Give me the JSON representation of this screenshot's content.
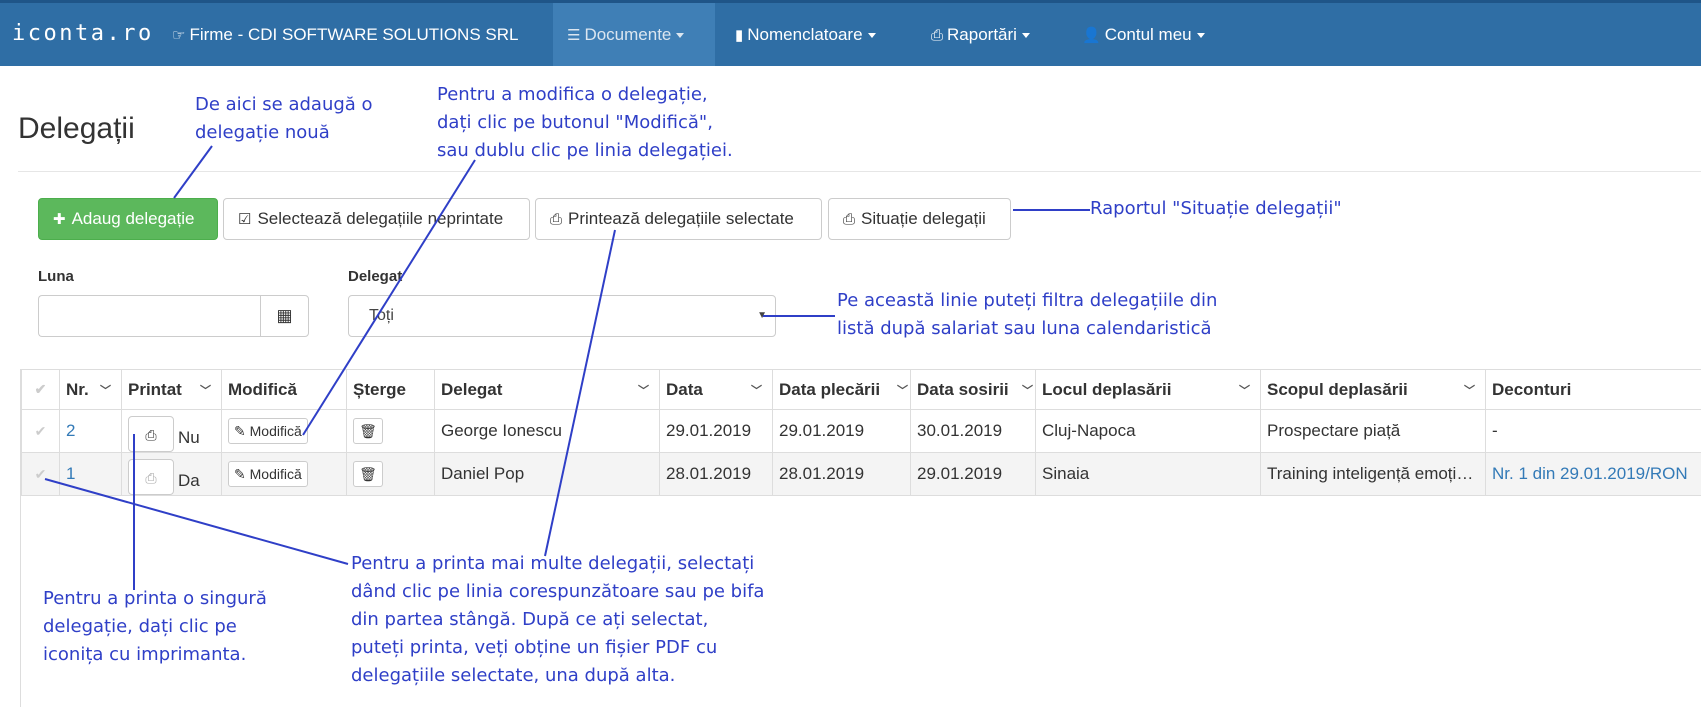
{
  "navbar": {
    "brand": "iconta.ro",
    "items": [
      {
        "label": "Firme - CDI SOFTWARE SOLUTIONS SRL",
        "icon": "external-link-icon"
      },
      {
        "label": "Documente",
        "icon": "list-icon"
      },
      {
        "label": "Nomenclatoare",
        "icon": "file-icon"
      },
      {
        "label": "Raportări",
        "icon": "print-icon"
      },
      {
        "label": "Contul meu",
        "icon": "user-icon"
      }
    ]
  },
  "page": {
    "title": "Delegații"
  },
  "toolbar": {
    "add_label": "Adaug delegație",
    "select_unprinted_label": "Selectează delegațiile neprintate",
    "print_selected_label": "Printează delegațiile selectate",
    "situation_label": "Situație delegații"
  },
  "filters": {
    "month_label": "Luna",
    "month_value": "",
    "delegate_label": "Delegat",
    "delegate_value": "Toți"
  },
  "table": {
    "headers": {
      "nr": "Nr.",
      "printed": "Printat",
      "edit": "Modifică",
      "delete": "Șterge",
      "delegate": "Delegat",
      "date": "Data",
      "departure": "Data plecării",
      "arrival": "Data sosirii",
      "place": "Locul deplasării",
      "purpose": "Scopul deplasării",
      "settlements": "Deconturi"
    },
    "rows": [
      {
        "nr": "2",
        "printed": "Nu",
        "edit": "Modifică",
        "delegate": "George Ionescu",
        "date": "29.01.2019",
        "departure": "29.01.2019",
        "arrival": "30.01.2019",
        "place": "Cluj-Napoca",
        "purpose": "Prospectare piață",
        "settlements": "-"
      },
      {
        "nr": "1",
        "printed": "Da",
        "edit": "Modifică",
        "delegate": "Daniel Pop",
        "date": "28.01.2019",
        "departure": "28.01.2019",
        "arrival": "29.01.2019",
        "place": "Sinaia",
        "purpose": "Training inteligență emoționlă",
        "settlements": "Nr. 1 din 29.01.2019/RON"
      }
    ]
  },
  "annotations": {
    "add": [
      "De aici se adaugă o",
      "delegație nouă"
    ],
    "edit": [
      "Pentru a modifica o delegație,",
      "dați clic pe butonul \"Modifică\",",
      "sau dublu clic pe linia delegației."
    ],
    "report": [
      "Raportul \"Situație delegații\""
    ],
    "filter": [
      "Pe această linie puteți filtra delegațiile din",
      "listă după salariat sau luna calendaristică"
    ],
    "print_single": [
      "Pentru a printa o singură",
      "delegație, dați clic pe",
      "iconița cu imprimanta."
    ],
    "print_multi": [
      "Pentru a printa mai multe delegații, selectați",
      "dând clic pe linia corespunzătoare sau pe bifa",
      "din partea stângă. După ce ați selectat,",
      "puteți printa, veți obține un fișier PDF cu",
      "delegațiile selectate, una după alta."
    ]
  },
  "colors": {
    "navbar": "#2f6ea5",
    "success": "#5cb85c",
    "annotation": "#2f3fc7",
    "link": "#337ab7"
  }
}
